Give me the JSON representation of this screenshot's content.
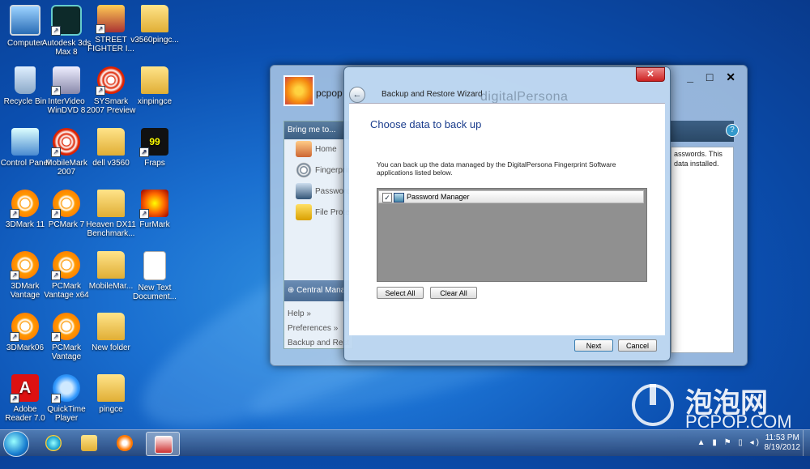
{
  "desktop": {
    "icons": [
      {
        "label": "Computer",
        "icon": "computer-icon"
      },
      {
        "label": "Autodesk 3ds Max 8",
        "icon": "autodesk-3ds-max-icon"
      },
      {
        "label": "STREET FIGHTER I...",
        "icon": "street-fighter-icon"
      },
      {
        "label": "v3560pingc...",
        "icon": "folder-icon"
      },
      {
        "label": "Recycle Bin",
        "icon": "recycle-bin-icon"
      },
      {
        "label": "InterVideo WinDVD 8",
        "icon": "windvd-icon"
      },
      {
        "label": "SYSmark 2007 Preview",
        "icon": "sysmark-icon"
      },
      {
        "label": "xinpingce",
        "icon": "folder-icon"
      },
      {
        "label": "Control Panel",
        "icon": "control-panel-icon"
      },
      {
        "label": "MobileMark 2007",
        "icon": "mobilemark-icon"
      },
      {
        "label": "dell v3560",
        "icon": "folder-icon"
      },
      {
        "label": "Fraps",
        "icon": "fraps-icon"
      },
      {
        "label": "3DMark 11",
        "icon": "3dmark-icon"
      },
      {
        "label": "PCMark 7",
        "icon": "pcmark-icon"
      },
      {
        "label": "Heaven DX11 Benchmark...",
        "icon": "folder-icon"
      },
      {
        "label": "FurMark",
        "icon": "furmark-icon"
      },
      {
        "label": "3DMark Vantage",
        "icon": "3dmark-vantage-icon"
      },
      {
        "label": "PCMark Vantage x64",
        "icon": "pcmark-vantage-icon"
      },
      {
        "label": "MobileMar...",
        "icon": "folder-icon"
      },
      {
        "label": "New Text Document...",
        "icon": "text-document-icon"
      },
      {
        "label": "3DMark06",
        "icon": "3dmark06-icon"
      },
      {
        "label": "PCMark Vantage",
        "icon": "pcmark-vantage-icon"
      },
      {
        "label": "New folder",
        "icon": "folder-icon"
      },
      {
        "label": "Adobe Reader 7.0",
        "icon": "adobe-reader-icon"
      },
      {
        "label": "QuickTime Player",
        "icon": "quicktime-icon"
      },
      {
        "label": "pingce",
        "icon": "folder-icon"
      }
    ]
  },
  "app_window": {
    "user_name": "pcpop",
    "controls": "_ □ ✕",
    "sidebar_header": "Bring me to...",
    "nav_items": [
      "Home",
      "Fingerprint",
      "Password",
      "File Prote"
    ],
    "central_label": "Central Mana",
    "links": [
      "Help »",
      "Preferences »",
      "Backup and Rest"
    ],
    "right_text": "asswords. This data installed.",
    "help_glyph": "?"
  },
  "dialog": {
    "title": "Backup and Restore Wizard",
    "brand": "digitalPersona",
    "close_glyph": "✕",
    "back_glyph": "←",
    "heading": "Choose data to back up",
    "description": "You can back up the data managed by the DigitalPersona Fingerprint Software applications listed below.",
    "items": [
      {
        "label": "Password Manager",
        "checked": true,
        "check_glyph": "✓"
      }
    ],
    "select_all": "Select All",
    "clear_all": "Clear All",
    "next": "Next",
    "cancel": "Cancel"
  },
  "taskbar": {
    "tray_icons": "▲ ▮ ⚑ ▯ ◂)",
    "time": "11:53 PM",
    "date": "8/19/2012"
  },
  "watermark": {
    "cn": "泡泡网",
    "en": "PCPOP.COM"
  }
}
